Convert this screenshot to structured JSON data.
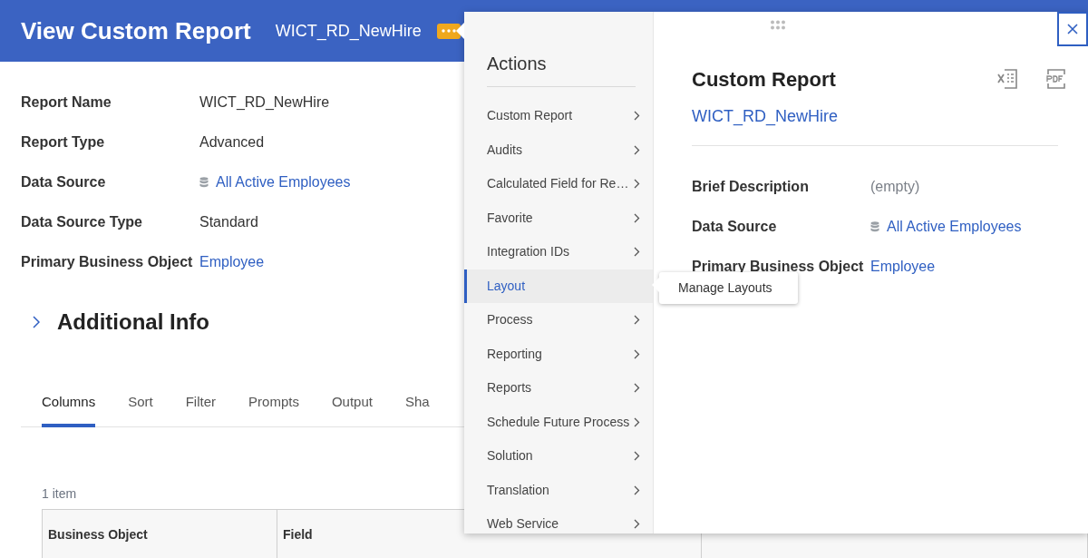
{
  "header": {
    "title": "View Custom Report",
    "subtitle": "WICT_RD_NewHire"
  },
  "fields": [
    {
      "label": "Report Name",
      "value": "WICT_RD_NewHire",
      "kind": "text"
    },
    {
      "label": "Report Type",
      "value": "Advanced",
      "kind": "text"
    },
    {
      "label": "Data Source",
      "value": "All Active Employees",
      "kind": "source"
    },
    {
      "label": "Data Source Type",
      "value": "Standard",
      "kind": "text"
    },
    {
      "label": "Primary Business Object",
      "value": "Employee",
      "kind": "link"
    }
  ],
  "additional_info": {
    "title": "Additional Info",
    "expanded": false
  },
  "tabs": [
    {
      "label": "Columns",
      "selected": true
    },
    {
      "label": "Sort",
      "selected": false
    },
    {
      "label": "Filter",
      "selected": false
    },
    {
      "label": "Prompts",
      "selected": false
    },
    {
      "label": "Output",
      "selected": false
    },
    {
      "label": "Sha",
      "selected": false
    }
  ],
  "table": {
    "count": "1 item",
    "columns": [
      "Business Object",
      "Field"
    ]
  },
  "actions_menu": {
    "title": "Actions",
    "items": [
      {
        "label": "Custom Report",
        "selected": false
      },
      {
        "label": "Audits",
        "selected": false
      },
      {
        "label": "Calculated Field for Re…",
        "selected": false
      },
      {
        "label": "Favorite",
        "selected": false
      },
      {
        "label": "Integration IDs",
        "selected": false
      },
      {
        "label": "Layout",
        "selected": true
      },
      {
        "label": "Process",
        "selected": false
      },
      {
        "label": "Reporting",
        "selected": false
      },
      {
        "label": "Reports",
        "selected": false
      },
      {
        "label": "Schedule Future Process",
        "selected": false
      },
      {
        "label": "Solution",
        "selected": false
      },
      {
        "label": "Translation",
        "selected": false
      },
      {
        "label": "Web Service",
        "selected": false
      }
    ],
    "submenu": [
      "Manage Layouts"
    ]
  },
  "detail_panel": {
    "title": "Custom Report",
    "link": "WICT_RD_NewHire",
    "fields": [
      {
        "label": "Brief Description",
        "value": "(empty)",
        "kind": "empty"
      },
      {
        "label": "Data Source",
        "value": "All Active Employees",
        "kind": "source"
      },
      {
        "label": "Primary Business Object",
        "value": "Employee",
        "kind": "link"
      }
    ]
  }
}
